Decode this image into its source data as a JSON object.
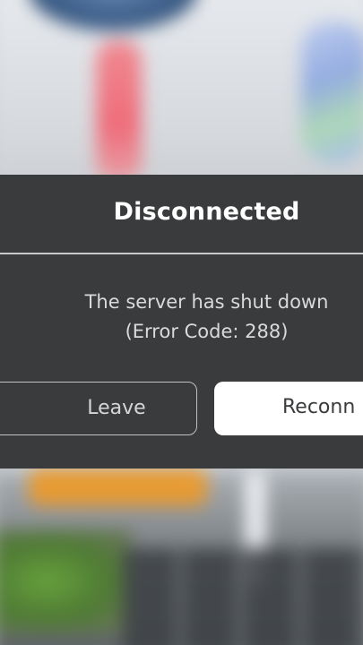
{
  "dialog": {
    "title": "Disconnected",
    "message_line1": "The server has shut down",
    "message_line2": "(Error Code: 288)",
    "leave_label": "Leave",
    "reconnect_label": "Reconn"
  },
  "colors": {
    "modal_bg": "#393b3d",
    "title_text": "#ffffff",
    "reconnect_bg": "#ffffff"
  }
}
